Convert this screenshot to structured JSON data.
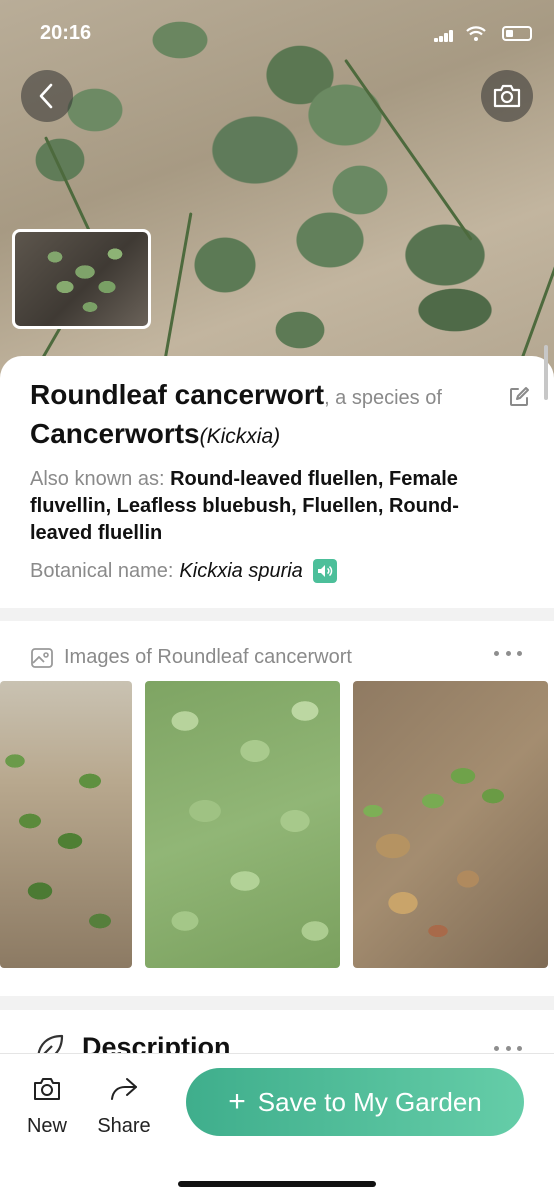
{
  "status_bar": {
    "time": "20:16"
  },
  "plant": {
    "common_name": "Roundleaf cancerwort",
    "species_of": ", a species of",
    "genus": "Cancerworts",
    "genus_latin": "(Kickxia)",
    "also_known_label": "Also known as: ",
    "also_known": "Round-leaved fluellen, Female fluvellin, Leafless bluebush, Fluellen, Round-leaved fluellin",
    "botanical_label": "Botanical name: ",
    "botanical_name": "Kickxia spuria"
  },
  "images_section": {
    "title": "Images of Roundleaf cancerwort"
  },
  "description_section": {
    "title": "Description"
  },
  "bottom_bar": {
    "new_label": "New",
    "share_label": "Share",
    "save_label": "Save to My Garden",
    "accent_color": "#4cbf9a"
  },
  "icons": [
    "back-arrow-icon",
    "camera-icon",
    "edit-icon",
    "speaker-icon",
    "gallery-icon",
    "more-dots-icon",
    "leaf-icon",
    "share-icon",
    "plus-icon"
  ]
}
